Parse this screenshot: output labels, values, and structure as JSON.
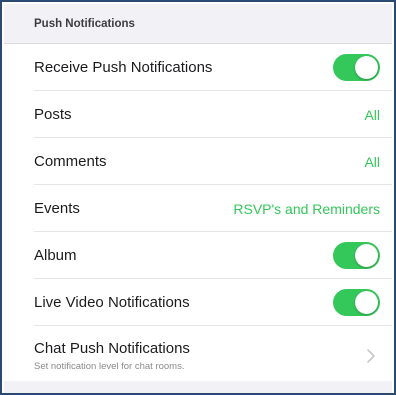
{
  "section": {
    "title": "Push Notifications"
  },
  "rows": {
    "receive_push": {
      "label": "Receive Push Notifications",
      "enabled": true
    },
    "posts": {
      "label": "Posts",
      "value": "All"
    },
    "comments": {
      "label": "Comments",
      "value": "All"
    },
    "events": {
      "label": "Events",
      "value": "RSVP's and Reminders"
    },
    "album": {
      "label": "Album",
      "enabled": true
    },
    "live_video": {
      "label": "Live Video Notifications",
      "enabled": true
    },
    "chat_push": {
      "label": "Chat Push Notifications",
      "subtitle": "Set notification level for chat rooms."
    }
  },
  "colors": {
    "accent": "#34c759",
    "frame_border": "#2b4a73",
    "header_bg": "#f2f2f6"
  },
  "icons": {
    "chat_push": "chevron-right-icon"
  }
}
